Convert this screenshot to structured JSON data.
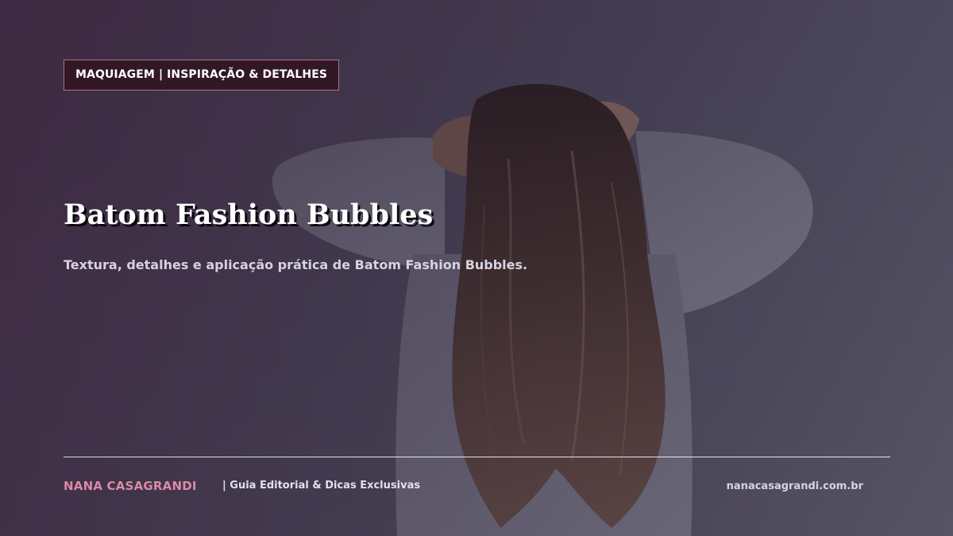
{
  "category_label": "MAQUIAGEM | INSPIRAÇÃO & DETALHES",
  "title": "Batom Fashion Bubbles",
  "subtitle": "Textura, detalhes e aplicação prática de Batom Fashion Bubbles.",
  "footer": {
    "brand": "NANA CASAGRANDI",
    "tagline": "|  Guia Editorial & Dicas Exclusivas",
    "site": "nanacasagrandi.com.br"
  },
  "colors": {
    "accent_pink": "#d98aa6",
    "badge_border": "#b06f8a",
    "badge_background": "#30141f"
  },
  "background_image": "woman-long-wavy-hair-from-behind"
}
